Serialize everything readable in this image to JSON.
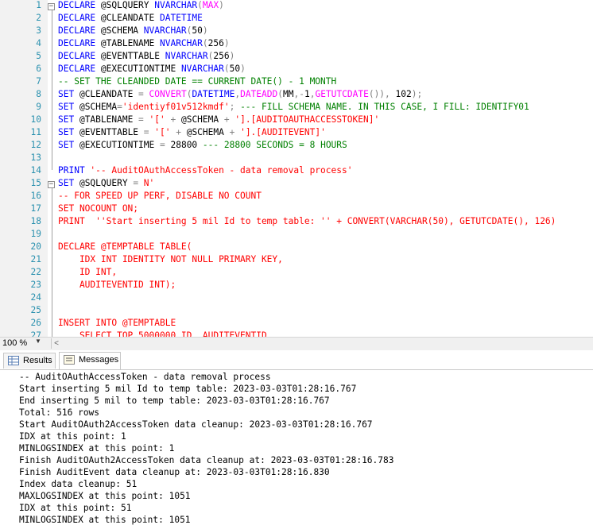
{
  "editor": {
    "lines": [
      {
        "n": "1",
        "parts": [
          [
            "kw",
            "DECLARE "
          ],
          [
            "tx",
            "@SQLQUERY "
          ],
          [
            "kw",
            "NVARCHAR"
          ],
          [
            "op",
            "("
          ],
          [
            "fn",
            "MAX"
          ],
          [
            "op",
            ")"
          ]
        ]
      },
      {
        "n": "2",
        "parts": [
          [
            "kw",
            "DECLARE "
          ],
          [
            "tx",
            "@CLEANDATE "
          ],
          [
            "kw",
            "DATETIME"
          ]
        ]
      },
      {
        "n": "3",
        "parts": [
          [
            "kw",
            "DECLARE "
          ],
          [
            "tx",
            "@SCHEMA "
          ],
          [
            "kw",
            "NVARCHAR"
          ],
          [
            "op",
            "("
          ],
          [
            "tx",
            "50"
          ],
          [
            "op",
            ")"
          ]
        ]
      },
      {
        "n": "4",
        "parts": [
          [
            "kw",
            "DECLARE "
          ],
          [
            "tx",
            "@TABLENAME "
          ],
          [
            "kw",
            "NVARCHAR"
          ],
          [
            "op",
            "("
          ],
          [
            "tx",
            "256"
          ],
          [
            "op",
            ")"
          ]
        ]
      },
      {
        "n": "5",
        "parts": [
          [
            "kw",
            "DECLARE "
          ],
          [
            "tx",
            "@EVENTTABLE "
          ],
          [
            "kw",
            "NVARCHAR"
          ],
          [
            "op",
            "("
          ],
          [
            "tx",
            "256"
          ],
          [
            "op",
            ")"
          ]
        ]
      },
      {
        "n": "6",
        "parts": [
          [
            "kw",
            "DECLARE "
          ],
          [
            "tx",
            "@EXECUTIONTIME "
          ],
          [
            "kw",
            "NVARCHAR"
          ],
          [
            "op",
            "("
          ],
          [
            "tx",
            "50"
          ],
          [
            "op",
            ")"
          ]
        ]
      },
      {
        "n": "7",
        "parts": [
          [
            "cm",
            "-- SET THE CLEANDED DATE == CURRENT DATE() - 1 MONTH"
          ]
        ]
      },
      {
        "n": "8",
        "parts": [
          [
            "kw",
            "SET "
          ],
          [
            "tx",
            "@CLEANDATE "
          ],
          [
            "op",
            "= "
          ],
          [
            "fn",
            "CONVERT"
          ],
          [
            "op",
            "("
          ],
          [
            "kw",
            "DATETIME"
          ],
          [
            "op",
            ","
          ],
          [
            "fn",
            "DATEADD"
          ],
          [
            "op",
            "("
          ],
          [
            "tx",
            "MM"
          ],
          [
            "op",
            ","
          ],
          [
            "op",
            "-"
          ],
          [
            "tx",
            "1"
          ],
          [
            "op",
            ","
          ],
          [
            "fn",
            "GETUTCDATE"
          ],
          [
            "op",
            "()), "
          ],
          [
            "tx",
            "102"
          ],
          [
            "op",
            ");"
          ]
        ]
      },
      {
        "n": "9",
        "parts": [
          [
            "kw",
            "SET "
          ],
          [
            "tx",
            "@SCHEMA"
          ],
          [
            "op",
            "="
          ],
          [
            "str",
            "'identiyf01v512kmdf'"
          ],
          [
            "op",
            "; "
          ],
          [
            "cm",
            "--- FILL SCHEMA NAME. IN THIS CASE, I FILL: IDENTIFY01"
          ]
        ]
      },
      {
        "n": "10",
        "parts": [
          [
            "kw",
            "SET "
          ],
          [
            "tx",
            "@TABLENAME "
          ],
          [
            "op",
            "= "
          ],
          [
            "str",
            "'[' "
          ],
          [
            "op",
            "+ "
          ],
          [
            "tx",
            "@SCHEMA "
          ],
          [
            "op",
            "+ "
          ],
          [
            "str",
            "'].[AUDITOAUTHACCESSTOKEN]'"
          ]
        ]
      },
      {
        "n": "11",
        "parts": [
          [
            "kw",
            "SET "
          ],
          [
            "tx",
            "@EVENTTABLE "
          ],
          [
            "op",
            "= "
          ],
          [
            "str",
            "'[' "
          ],
          [
            "op",
            "+ "
          ],
          [
            "tx",
            "@SCHEMA "
          ],
          [
            "op",
            "+ "
          ],
          [
            "str",
            "'].[AUDITEVENT]'"
          ]
        ]
      },
      {
        "n": "12",
        "parts": [
          [
            "kw",
            "SET "
          ],
          [
            "tx",
            "@EXECUTIONTIME "
          ],
          [
            "op",
            "= "
          ],
          [
            "tx",
            "28800 "
          ],
          [
            "cm",
            "--- 28800 SECONDS = 8 HOURS"
          ]
        ]
      },
      {
        "n": "13",
        "parts": []
      },
      {
        "n": "14",
        "parts": [
          [
            "kw",
            "PRINT "
          ],
          [
            "str",
            "'-- AuditOAuthAccessToken - data removal process'"
          ]
        ]
      },
      {
        "n": "15",
        "parts": [
          [
            "kw",
            "SET "
          ],
          [
            "tx",
            "@SQLQUERY "
          ],
          [
            "op",
            "= "
          ],
          [
            "str",
            "N'"
          ]
        ]
      },
      {
        "n": "16",
        "parts": [
          [
            "str",
            "-- FOR SPEED UP PERF, DISABLE NO COUNT"
          ]
        ]
      },
      {
        "n": "17",
        "parts": [
          [
            "str",
            "SET NOCOUNT ON;"
          ]
        ]
      },
      {
        "n": "18",
        "parts": [
          [
            "str",
            "PRINT  ''Start inserting 5 mil Id to temp table: '' + CONVERT(VARCHAR(50), GETUTCDATE(), 126)"
          ]
        ]
      },
      {
        "n": "19",
        "parts": []
      },
      {
        "n": "20",
        "parts": [
          [
            "str",
            "DECLARE @TEMPTABLE TABLE("
          ]
        ]
      },
      {
        "n": "21",
        "parts": [
          [
            "str",
            "    IDX INT IDENTITY NOT NULL PRIMARY KEY,"
          ]
        ]
      },
      {
        "n": "22",
        "parts": [
          [
            "str",
            "    ID INT,"
          ]
        ]
      },
      {
        "n": "23",
        "parts": [
          [
            "str",
            "    AUDITEVENTID INT);"
          ]
        ]
      },
      {
        "n": "24",
        "parts": []
      },
      {
        "n": "25",
        "parts": []
      },
      {
        "n": "26",
        "parts": [
          [
            "str",
            "INSERT INTO @TEMPTABLE"
          ]
        ]
      },
      {
        "n": "27",
        "parts": [
          [
            "str",
            "    SELECT TOP 5000000 ID, AUDITEVENTID"
          ]
        ]
      }
    ]
  },
  "status": {
    "zoom": "100 %"
  },
  "tabs": [
    {
      "label": "Results",
      "active": false
    },
    {
      "label": "Messages",
      "active": true
    }
  ],
  "messages": [
    "-- AuditOAuthAccessToken - data removal process",
    "Start inserting 5 mil Id to temp table: 2023-03-03T01:28:16.767",
    "End inserting 5 mil to temp table: 2023-03-03T01:28:16.767",
    "Total: 516 rows",
    "Start AuditOAuth2AccessToken data cleanup: 2023-03-03T01:28:16.767",
    "IDX at this point: 1",
    "MINLOGSINDEX at this point: 1",
    "Finish AuditOAuth2AccessToken data cleanup at: 2023-03-03T01:28:16.783",
    "Finish AuditEvent data cleanup at: 2023-03-03T01:28:16.830",
    "Index data cleanup: 51",
    "MAXLOGSINDEX at this point: 1051",
    "IDX at this point: 51",
    "MINLOGSINDEX at this point: 1051"
  ]
}
